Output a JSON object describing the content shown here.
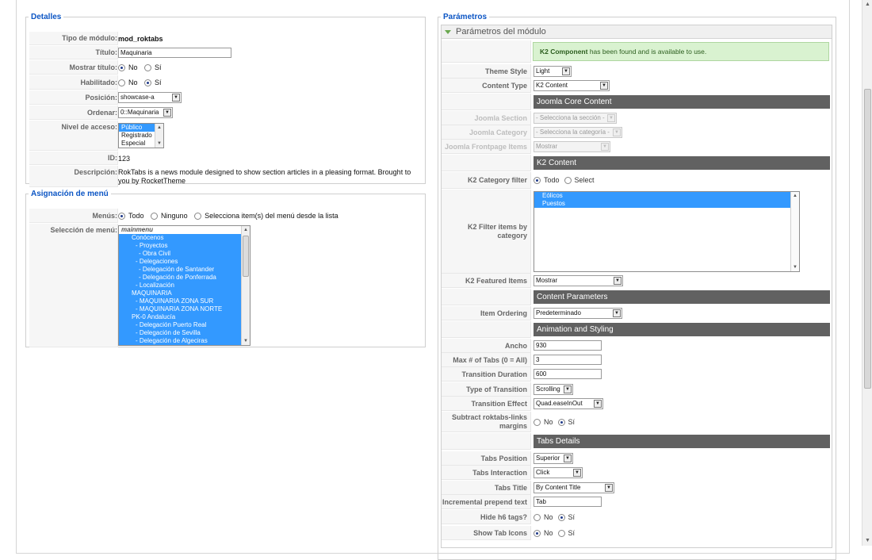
{
  "details": {
    "legend": "Detalles",
    "rows": [
      {
        "label": "Tipo de módulo:",
        "value": "mod_roktabs"
      },
      {
        "label": "Título:",
        "value": "Maquinaria"
      },
      {
        "label": "Mostrar título:",
        "opt_no": "No",
        "opt_si": "Sí",
        "selected": "No"
      },
      {
        "label": "Habilitado:",
        "opt_no": "No",
        "opt_si": "Sí",
        "selected": "Sí"
      },
      {
        "label": "Posición:",
        "value": "showcase-a"
      },
      {
        "label": "Ordenar:",
        "value": "0::Maquinaria"
      },
      {
        "label": "Nivel de acceso:",
        "options": [
          "Público",
          "Registrado",
          "Especial"
        ],
        "selected": "Público"
      },
      {
        "label": "ID:",
        "value": "123"
      },
      {
        "label": "Descripción:",
        "value": "RokTabs is a news module designed to show section articles in a pleasing format. Brought to you by RocketTheme"
      }
    ]
  },
  "menu": {
    "legend": "Asignación de menú",
    "menus_label": "Menús:",
    "menus_options": [
      "Todo",
      "Ninguno",
      "Selecciona item(s) del menú desde la lista"
    ],
    "menus_selected": "Todo",
    "selection_label": "Selección de menú:",
    "items": [
      "mainmenu",
      "Conócenos",
      "- Proyectos",
      "- Obra Civil",
      "- Delegaciones",
      "- Delegación de Santander",
      "- Delegación de Ponferrada",
      "- Localización",
      "MAQUINARIA",
      "- MAQUINARIA ZONA SUR",
      "- MAQUINARIA ZONA NORTE",
      "PK-0 Andalucía",
      "- Delegación Puerto Real",
      "- Delegación de Sevilla",
      "- Delegación de Algeciras"
    ]
  },
  "params": {
    "legend": "Parámetros",
    "pane_title": "Parámetros del módulo",
    "notice_bold": "K2 Component",
    "notice_rest": " has been found and is available to use.",
    "theme_style": {
      "label": "Theme Style",
      "value": "Light"
    },
    "content_type": {
      "label": "Content Type",
      "value": "K2 Content"
    },
    "hdr_core": "Joomla Core Content",
    "joomla_section": {
      "label": "Joomla Section",
      "value": "- Selecciona la sección -"
    },
    "joomla_category": {
      "label": "Joomla Category",
      "value": "- Selecciona la categoría -"
    },
    "joomla_frontpage": {
      "label": "Joomla Frontpage Items",
      "value": "Mostrar"
    },
    "hdr_k2": "K2 Content",
    "k2_cat_filter": {
      "label": "K2 Category filter",
      "opt_a": "Todo",
      "opt_b": "Select",
      "selected": "Todo"
    },
    "k2_filter_items": {
      "label": "K2 Filter items by category",
      "options": [
        "Eólicos",
        "Puestos"
      ]
    },
    "k2_featured": {
      "label": "K2 Featured Items",
      "value": "Mostrar"
    },
    "hdr_content": "Content Parameters",
    "item_ordering": {
      "label": "Item Ordering",
      "value": "Predeterminado"
    },
    "hdr_anim": "Animation and Styling",
    "ancho": {
      "label": "Ancho",
      "value": "930"
    },
    "max_tabs": {
      "label": "Max # of Tabs (0 = All)",
      "value": "3"
    },
    "transition_duration": {
      "label": "Transition Duration",
      "value": "600"
    },
    "type_transition": {
      "label": "Type of Transition",
      "value": "Scrolling"
    },
    "transition_effect": {
      "label": "Transition Effect",
      "value": "Quad.easeInOut"
    },
    "subtract_margins": {
      "label": "Subtract roktabs-links margins",
      "opt_no": "No",
      "opt_si": "Sí",
      "selected": "Sí"
    },
    "hdr_tabs": "Tabs Details",
    "tabs_position": {
      "label": "Tabs Position",
      "value": "Superior"
    },
    "tabs_interaction": {
      "label": "Tabs Interaction",
      "value": "Click"
    },
    "tabs_title": {
      "label": "Tabs Title",
      "value": "By Content Title"
    },
    "incremental_prepend": {
      "label": "Incremental prepend text",
      "value": "Tab"
    },
    "hide_h6": {
      "label": "Hide h6 tags?",
      "opt_no": "No",
      "opt_si": "Sí",
      "selected": "Sí"
    },
    "show_tab_icons": {
      "label": "Show Tab Icons",
      "opt_no": "No",
      "opt_si": "Sí",
      "selected": "No"
    }
  },
  "colors": {
    "accent": "#0b55c4",
    "header_bar": "#616161",
    "list_highlight": "#3399ff",
    "notice_bg": "#d9f2d0"
  }
}
